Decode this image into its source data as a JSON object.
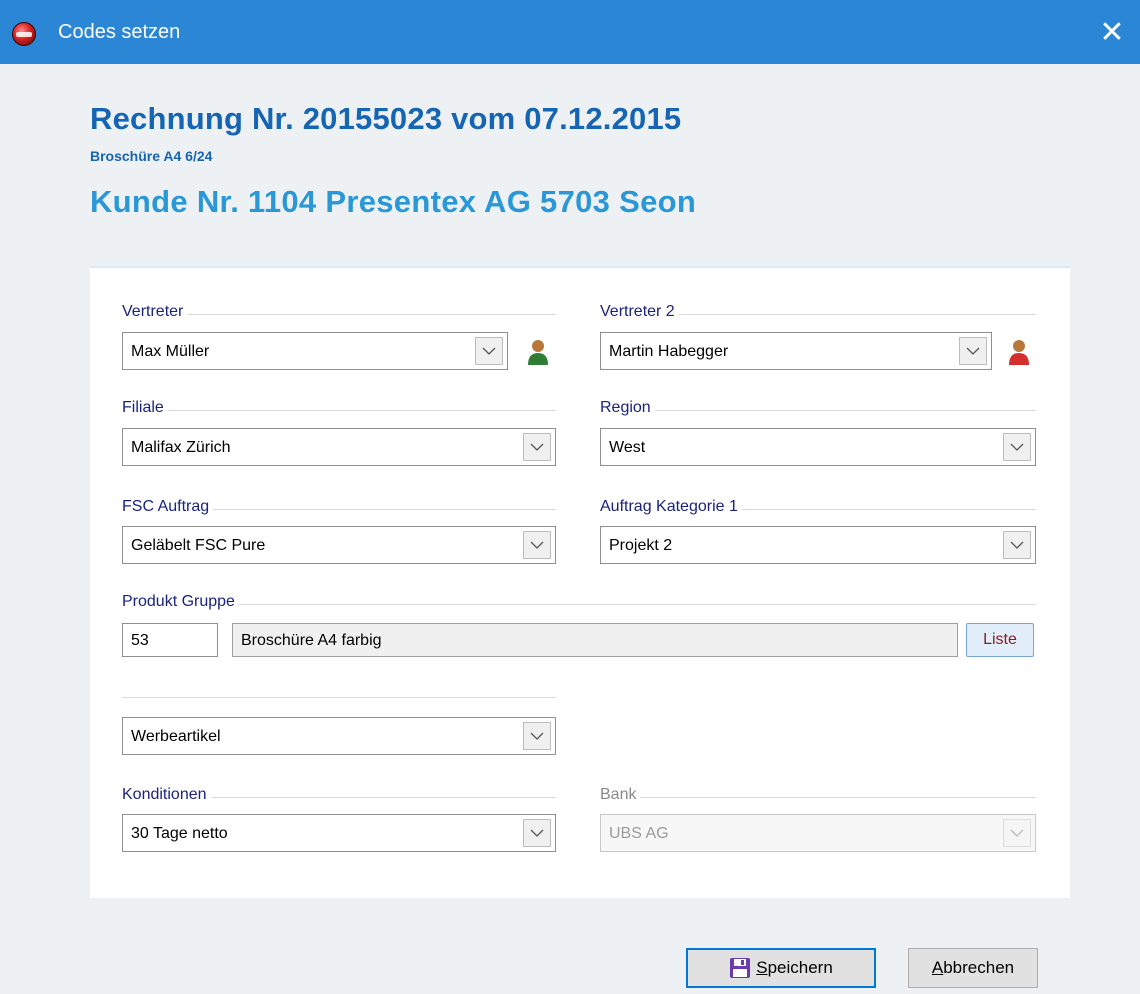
{
  "window": {
    "title": "Codes setzen",
    "close_glyph": "✕"
  },
  "header": {
    "line1": "Rechnung Nr. 20155023 vom 07.12.2015",
    "line2": "Broschüre A4 6/24",
    "line3": "Kunde Nr. 1104 Presentex AG 5703 Seon"
  },
  "form": {
    "vertreter": {
      "label": "Vertreter",
      "value": "Max Müller",
      "icon_color": "#2e7d32"
    },
    "vertreter2": {
      "label": "Vertreter 2",
      "value": "Martin Habegger",
      "icon_color": "#d32f2f"
    },
    "filiale": {
      "label": "Filiale",
      "value": "Malifax Zürich"
    },
    "region": {
      "label": "Region",
      "value": "West"
    },
    "fsc": {
      "label": "FSC Auftrag",
      "value": "Geläbelt FSC Pure"
    },
    "kategorie1": {
      "label": "Auftrag Kategorie 1",
      "value": "Projekt 2"
    },
    "produkt_gruppe": {
      "label": "Produkt Gruppe",
      "code": "53",
      "name": "Broschüre A4 farbig",
      "list_button": "Liste"
    },
    "werbeartikel": {
      "value": "Werbeartikel"
    },
    "konditionen": {
      "label": "Konditionen",
      "value": "30 Tage netto"
    },
    "bank": {
      "label": "Bank",
      "value": "UBS AG",
      "disabled": true
    }
  },
  "buttons": {
    "save_mnemonic": "S",
    "save_rest": "peichern",
    "cancel_mnemonic": "A",
    "cancel_rest": "bbrechen"
  }
}
